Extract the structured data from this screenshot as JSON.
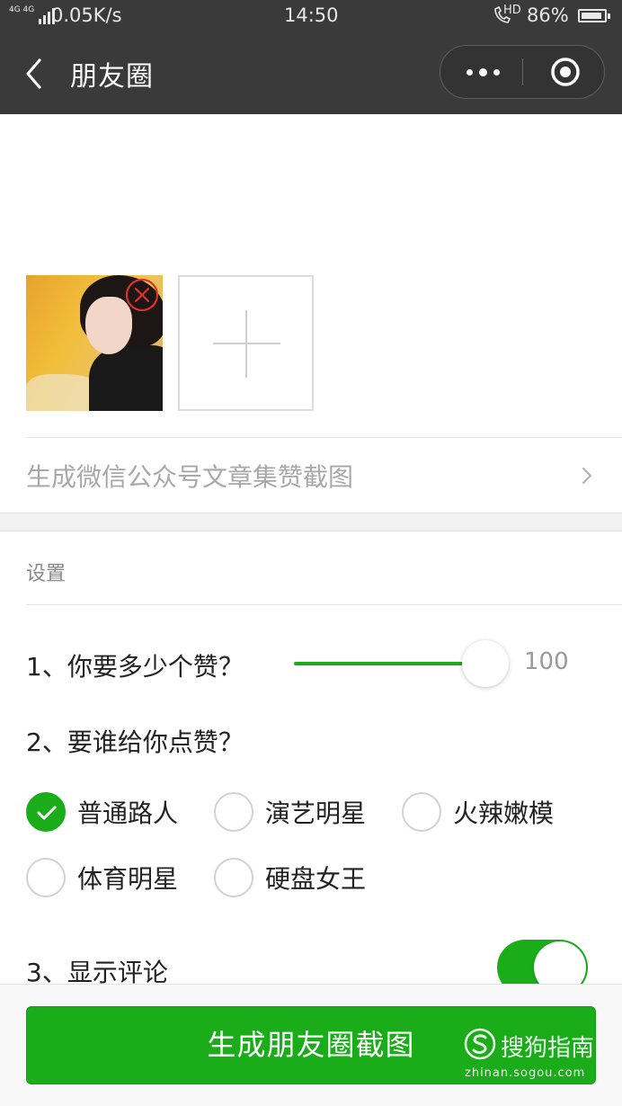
{
  "status_bar": {
    "network": "4G 4G",
    "speed": "0.05K/s",
    "time": "14:50",
    "hd": "HD",
    "battery": "86%"
  },
  "nav": {
    "title": "朋友圈"
  },
  "article_link": {
    "label": "生成微信公众号文章集赞截图"
  },
  "settings": {
    "title": "设置",
    "q1": "1、你要多少个赞？",
    "likes_value": "100",
    "slider_fraction": 0.82,
    "q2": "2、要谁给你点赞？",
    "options": [
      {
        "label": "普通路人",
        "checked": true
      },
      {
        "label": "演艺明星",
        "checked": false
      },
      {
        "label": "火辣嫩模",
        "checked": false
      },
      {
        "label": "体育明星",
        "checked": false
      },
      {
        "label": "硬盘女王",
        "checked": false
      }
    ],
    "q3": "3、显示评论",
    "show_comments": true
  },
  "footer": {
    "button_label": "生成朋友圈截图"
  },
  "watermark": {
    "brand": "搜狗指南",
    "url": "zhinan.sogou.com"
  },
  "colors": {
    "accent": "#1aad19",
    "bar": "#3a3a3a"
  }
}
